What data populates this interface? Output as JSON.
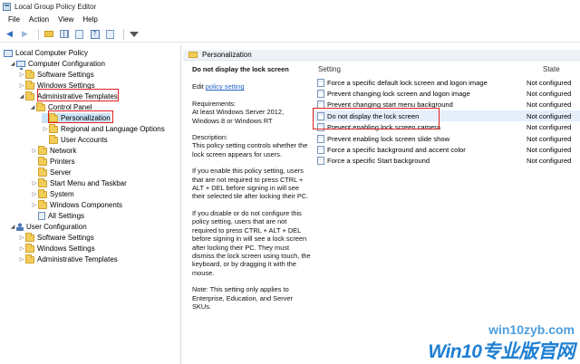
{
  "window": {
    "title": "Local Group Policy Editor"
  },
  "menu": [
    "File",
    "Action",
    "View",
    "Help"
  ],
  "toolbar": {
    "icons": [
      "back-arrow-icon",
      "forward-arrow-icon",
      "up-folder-icon",
      "show-hide-tree-icon",
      "export-list-icon",
      "help-icon",
      "properties-icon",
      "filter-icon"
    ]
  },
  "tree": {
    "items": [
      {
        "label": "Local Computer Policy"
      },
      {
        "label": "Computer Configuration"
      },
      {
        "label": "Software Settings"
      },
      {
        "label": "Windows Settings"
      },
      {
        "label": "Administrative Templates"
      },
      {
        "label": "Control Panel"
      },
      {
        "label": "Personalization"
      },
      {
        "label": "Regional and Language Options"
      },
      {
        "label": "User Accounts"
      },
      {
        "label": "Network"
      },
      {
        "label": "Printers"
      },
      {
        "label": "Server"
      },
      {
        "label": "Start Menu and Taskbar"
      },
      {
        "label": "System"
      },
      {
        "label": "Windows Components"
      },
      {
        "label": "All Settings"
      },
      {
        "label": "User Configuration"
      },
      {
        "label": "Software Settings"
      },
      {
        "label": "Windows Settings"
      },
      {
        "label": "Administrative Templates"
      }
    ]
  },
  "details": {
    "header": "Personalization",
    "title": "Do not display the lock screen",
    "edit_prefix": "Edit ",
    "edit_link": "policy setting",
    "requirements_label": "Requirements:",
    "requirements_text": "At least Windows Server 2012, Windows 8 or Windows RT",
    "description_label": "Description:",
    "description_text": "This policy setting controls whether the lock screen appears for users.",
    "para_enable": "If you enable this policy setting, users that are not required to press CTRL + ALT + DEL before signing in will see their selected tile after locking their PC.",
    "para_disable": "If you disable or do not configure this policy setting, users that are not required to press CTRL + ALT + DEL before signing in will see a lock screen after locking their PC. They must dismiss the lock screen using touch, the keyboard, or by dragging it with the mouse.",
    "note": "Note: This setting only applies to Enterprise, Education, and Server SKUs."
  },
  "settings_list": {
    "col_setting": "Setting",
    "col_state": "State",
    "rows": [
      {
        "name": "Force a specific default lock screen and logon image",
        "state": "Not configured"
      },
      {
        "name": "Prevent changing lock screen and logon image",
        "state": "Not configured"
      },
      {
        "name": "Prevent changing start menu background",
        "state": "Not configured"
      },
      {
        "name": "Do not display the lock screen",
        "state": "Not configured"
      },
      {
        "name": "Prevent enabling lock screen camera",
        "state": "Not configured"
      },
      {
        "name": "Prevent enabling lock screen slide show",
        "state": "Not configured"
      },
      {
        "name": "Force a specific background and accent color",
        "state": "Not configured"
      },
      {
        "name": "Force a specific Start background",
        "state": "Not configured"
      }
    ]
  },
  "watermark": {
    "site": "win10zyb.com",
    "brand": "Win10专业版官网"
  },
  "colors": {
    "highlight": "#e02020",
    "link": "#2166c4",
    "selected_row": "#e5eef9"
  }
}
